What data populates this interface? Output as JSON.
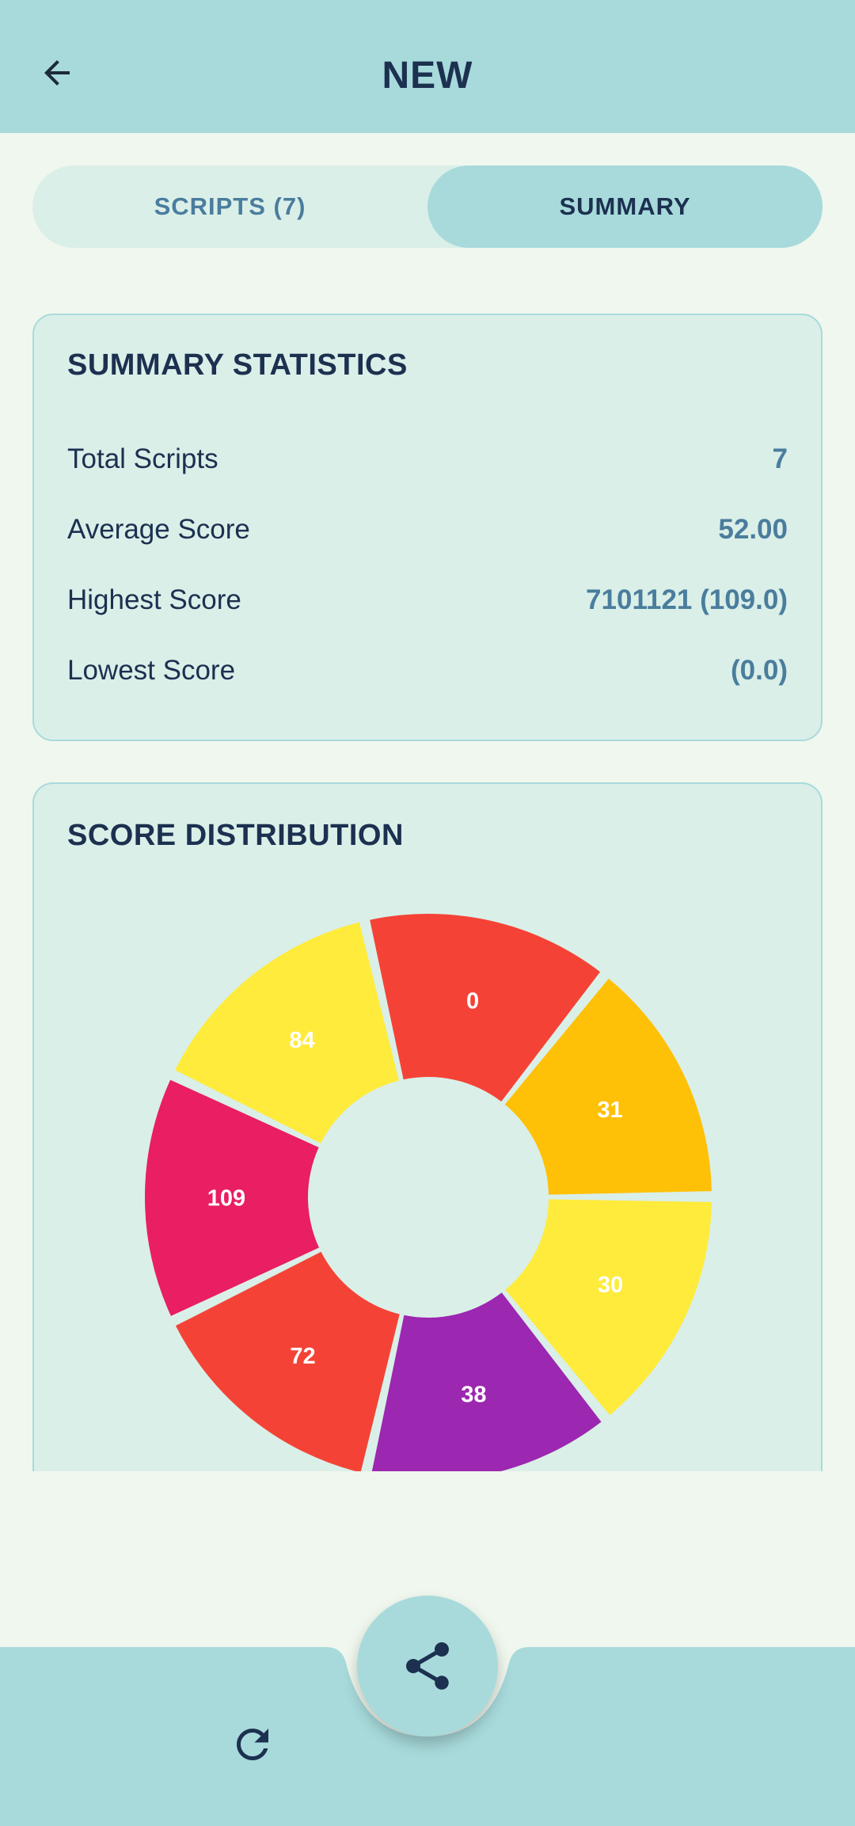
{
  "header": {
    "title": "NEW",
    "back_icon": "arrow-left-icon"
  },
  "tabs": [
    {
      "label": "SCRIPTS (7)",
      "active": false
    },
    {
      "label": "SUMMARY",
      "active": true
    }
  ],
  "summary": {
    "title": "SUMMARY STATISTICS",
    "rows": [
      {
        "label": "Total Scripts",
        "value": "7"
      },
      {
        "label": "Average Score",
        "value": "52.00"
      },
      {
        "label": "Highest Score",
        "value": "7101121 (109.0)"
      },
      {
        "label": "Lowest Score",
        "value": "(0.0)"
      }
    ]
  },
  "distribution": {
    "title": "SCORE DISTRIBUTION"
  },
  "chart_data": {
    "type": "pie",
    "categories": [
      "0",
      "31",
      "30",
      "38",
      "72",
      "109",
      "84"
    ],
    "values": [
      0,
      31,
      30,
      38,
      72,
      109,
      84
    ],
    "slice_labels": [
      "0",
      "31",
      "30",
      "38",
      "72",
      "109",
      "84"
    ],
    "colors": [
      "#f44336",
      "#ffc107",
      "#ffeb3b",
      "#9c27b0",
      "#f44336",
      "#e91e63",
      "#ffeb3b"
    ],
    "note_equal_slices": true
  },
  "bottom_bar": {
    "refresh_icon": "refresh-icon",
    "share_icon": "share-icon"
  },
  "colors": {
    "header_bg": "#a8dadb",
    "page_bg": "#f0f7ee",
    "card_bg": "#daefe8",
    "text_dark": "#1c3050",
    "text_accent": "#4a7d9d"
  }
}
